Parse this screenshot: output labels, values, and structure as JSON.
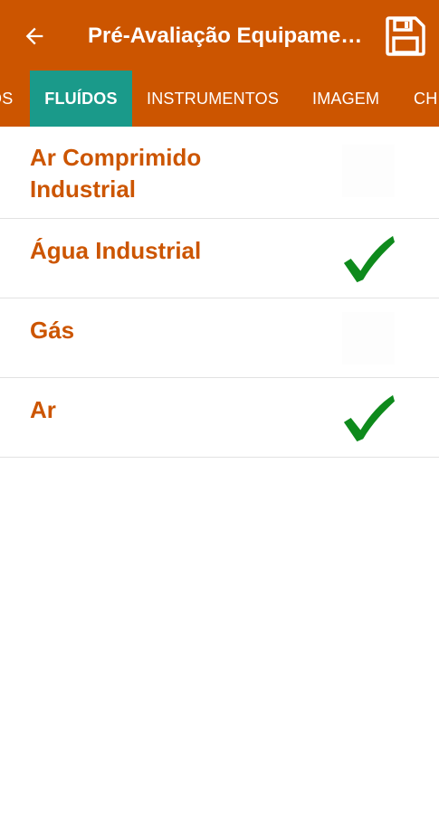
{
  "header": {
    "title": "Pré-Avaliação Equipamento",
    "back_icon": "arrow-left-icon",
    "save_icon": "floppy-disk-icon",
    "background_color": "#cc5500",
    "text_color": "#ffffff"
  },
  "tabs": {
    "items": [
      {
        "label": "OS",
        "active": false
      },
      {
        "label": "FLUÍDOS",
        "active": true
      },
      {
        "label": "INSTRUMENTOS",
        "active": false
      },
      {
        "label": "IMAGEM",
        "active": false
      },
      {
        "label": "CH",
        "active": false
      }
    ],
    "active_color": "#1a9a8a"
  },
  "fluids": {
    "items": [
      {
        "label": "Ar Comprimido Industrial",
        "checked": false
      },
      {
        "label": "Água Industrial",
        "checked": true
      },
      {
        "label": "Gás",
        "checked": false
      },
      {
        "label": "Ar",
        "checked": true
      }
    ],
    "label_color": "#cc5500",
    "check_color": "#0e8a1c",
    "check_icon": "checkmark-icon"
  }
}
